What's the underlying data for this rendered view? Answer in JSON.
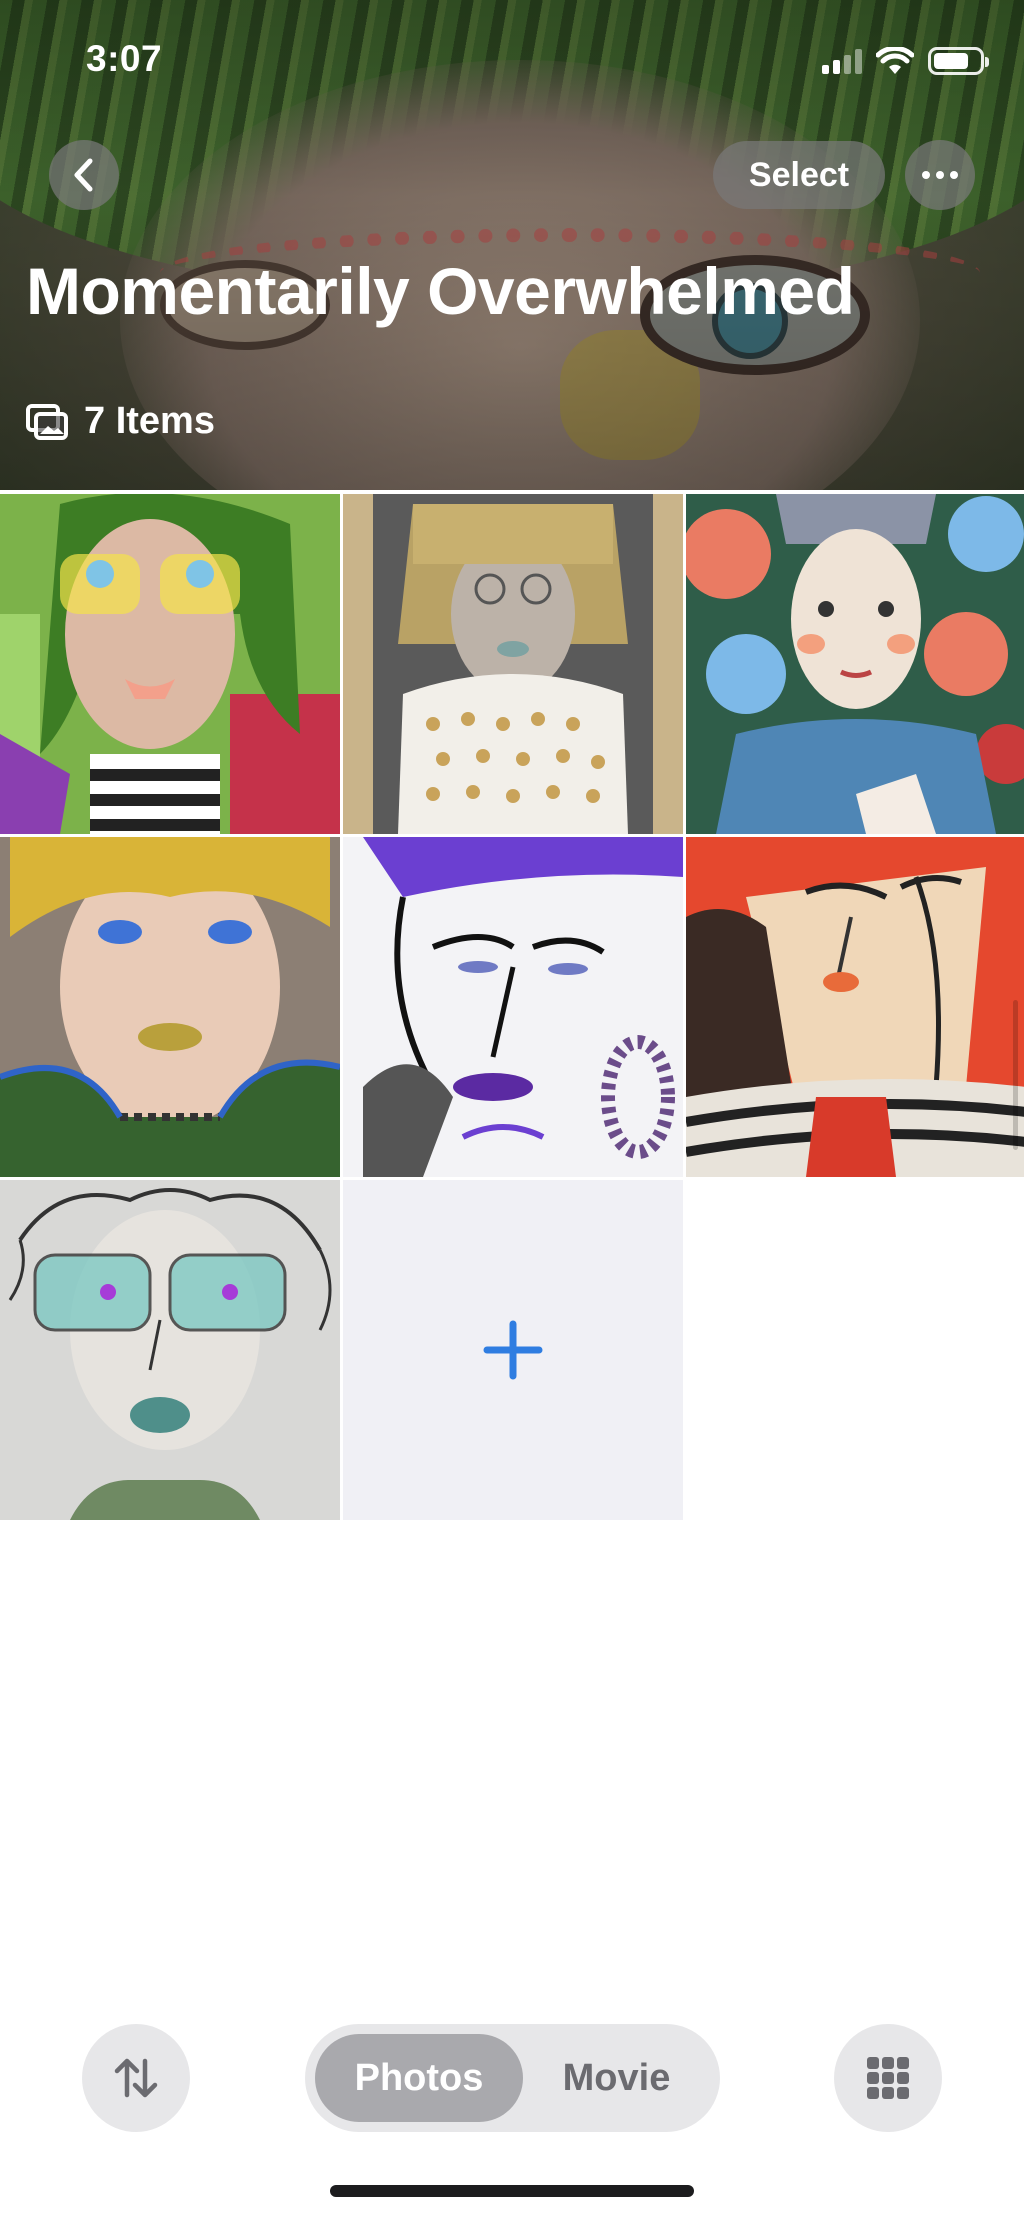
{
  "status_bar": {
    "time": "3:07"
  },
  "header": {
    "select_label": "Select",
    "title": "Momentarily Overwhelmed",
    "item_count": "7 Items"
  },
  "grid": {
    "items": [
      {
        "kind": "illustrated portrait",
        "palette": [
          "#6fa03a",
          "#d9b7a5",
          "#f5e14a"
        ]
      },
      {
        "kind": "illustrated portrait",
        "palette": [
          "#b9a265",
          "#777777",
          "#f2efe9"
        ]
      },
      {
        "kind": "illustrated portrait",
        "palette": [
          "#2f5d49",
          "#ea7b63",
          "#4f86b5"
        ]
      },
      {
        "kind": "illustrated portrait",
        "palette": [
          "#d9b437",
          "#e9cbb7",
          "#36632f"
        ]
      },
      {
        "kind": "illustrated portrait",
        "palette": [
          "#6b3fd1",
          "#ffffff",
          "#1a1a1a"
        ]
      },
      {
        "kind": "illustrated portrait",
        "palette": [
          "#e5482e",
          "#f0d7b8",
          "#2b2b2b"
        ]
      },
      {
        "kind": "illustrated portrait",
        "palette": [
          "#d8d8d6",
          "#7fc9c3",
          "#333333"
        ]
      }
    ],
    "add_tile": {
      "icon": "plus-icon",
      "color": "#2f7de1"
    }
  },
  "toolbar": {
    "sort_icon": "sort-arrows-icon",
    "segments": [
      "Photos",
      "Movie"
    ],
    "selected_segment": "Photos",
    "grid_icon": "grid-icon"
  }
}
